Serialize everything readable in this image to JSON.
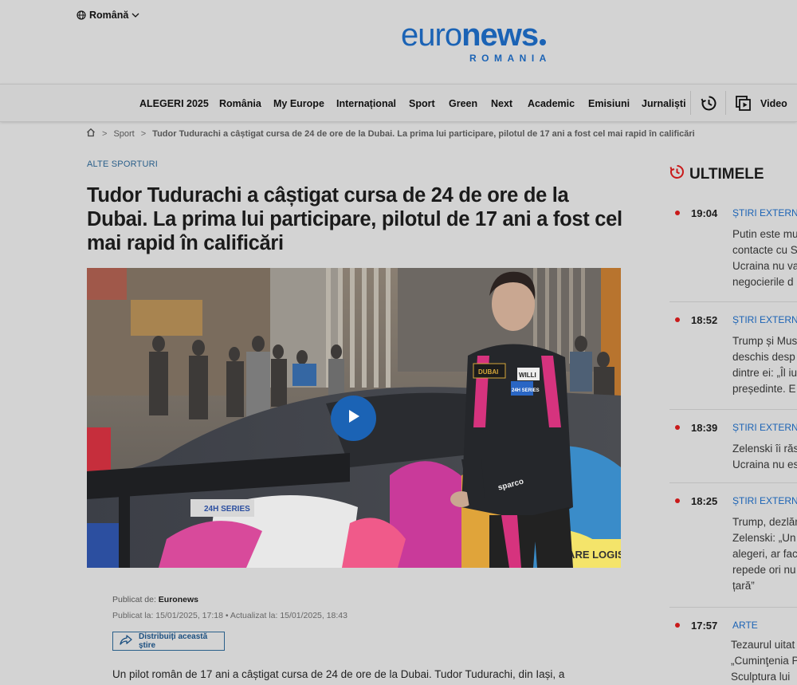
{
  "header": {
    "language": "Română",
    "logo_euro": "euro",
    "logo_news": "news",
    "logo_sub": "ROMANIA"
  },
  "nav": {
    "items": [
      "ALEGERI 2025",
      "România",
      "My Europe",
      "Internațional",
      "Sport",
      "Green",
      "Next",
      "Academic",
      "Emisiuni",
      "Jurnaliști"
    ],
    "video_label": "Video"
  },
  "breadcrumb": {
    "section": "Sport",
    "current": "Tudor Tudurachi a câștigat cursa de 24 de ore de la Dubai. La prima lui participare, pilotul de 17 ani a fost cel mai rapid în calificări"
  },
  "article": {
    "category": "ALTE SPORTURI",
    "title": "Tudor Tudurachi a câștigat cursa de 24 de ore de la Dubai. La prima lui participare, pilotul de 17 ani a fost cel mai rapid în calificări",
    "published_by_label": "Publicat de:",
    "published_by": "Euronews",
    "published_dates": "Publicat la: 15/01/2025, 17:18 • Actualizat la: 15/01/2025, 18:43",
    "share_label": "Distribuiți această știre",
    "lead": "Un pilot român de 17 ani a câștigat cursa de 24 de ore de la Dubai. Tudor Tudurachi, din Iași, a"
  },
  "hero": {
    "car_texts": [
      "24H SERIES",
      "SHARE LOGISTIC",
      "sparco",
      "DUBAI",
      "WILLI",
      "24H SERIES"
    ]
  },
  "sidebar": {
    "heading": "ULTIMELE",
    "items": [
      {
        "time": "19:04",
        "category": "ȘTIRI EXTERNE",
        "text": "Putin este mu\ncontacte cu S\nUcraina nu va\nnegocierile d"
      },
      {
        "time": "18:52",
        "category": "ȘTIRI EXTERNE",
        "text": "Trump și Mus\ndeschis desp\ndintre ei: „Îl iu\npreședinte. E"
      },
      {
        "time": "18:39",
        "category": "ȘTIRI EXTERNE",
        "text": "Zelenski îi răs\nUcraina nu es"
      },
      {
        "time": "18:25",
        "category": "ȘTIRI EXTERNE",
        "text": "Trump, dezlăn\nZelenski: „Un\nalegeri, ar fac\nrepede ori nu\nțară”"
      },
      {
        "time": "17:57",
        "category": "ARTE",
        "text": "Tezaurul uitat\n„Cuminţenia P\nSculptura lui"
      }
    ]
  },
  "colors": {
    "brand_blue": "#1b63b5",
    "live_red": "#c91a1a",
    "background": "#d3d3d3"
  },
  "icons": [
    "globe-icon",
    "chevron-down-icon",
    "history-icon",
    "video-icon",
    "home-icon",
    "play-icon",
    "share-icon",
    "latest-icon"
  ]
}
